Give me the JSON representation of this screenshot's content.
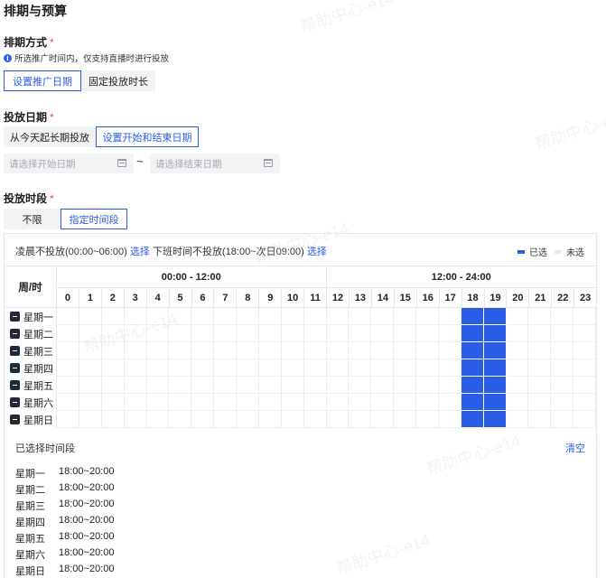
{
  "section_title": "排期与预算",
  "schedule_mode": {
    "label": "排期方式",
    "required_mark": "*",
    "info_text": "所选推广时间内，仅支持直播时进行投放",
    "options": [
      {
        "label": "设置推广日期",
        "active": true
      },
      {
        "label": "固定投放时长",
        "active": false
      }
    ]
  },
  "delivery_date": {
    "label": "投放日期",
    "required_mark": "*",
    "options": [
      {
        "label": "从今天起长期投放",
        "active": false
      },
      {
        "label": "设置开始和结束日期",
        "active": true
      }
    ],
    "start_placeholder": "请选择开始日期",
    "end_placeholder": "请选择结束日期",
    "separator": "~"
  },
  "time_slot": {
    "label": "投放时段",
    "required_mark": "*",
    "options": [
      {
        "label": "不限",
        "active": false
      },
      {
        "label": "指定时间段",
        "active": true
      }
    ]
  },
  "panel": {
    "quick1_text": "凌晨不投放(00:00~06:00)",
    "quick1_link": "选择",
    "quick2_text": "下班时间不投放(18:00~次日09:00)",
    "quick2_link": "选择",
    "legend_selected": "已选",
    "legend_unselected": "未选",
    "colors": {
      "selected": "#2b5ce6",
      "unselected": "#f0f1f3"
    },
    "corner_label": "周/时",
    "half_labels": [
      "00:00 - 12:00",
      "12:00 - 24:00"
    ],
    "hours": [
      "0",
      "1",
      "2",
      "3",
      "4",
      "5",
      "6",
      "7",
      "8",
      "9",
      "10",
      "11",
      "12",
      "13",
      "14",
      "15",
      "16",
      "17",
      "18",
      "19",
      "20",
      "21",
      "22",
      "23"
    ],
    "days": [
      "星期一",
      "星期二",
      "星期三",
      "星期四",
      "星期五",
      "星期六",
      "星期日"
    ],
    "selected_hours": [
      18,
      19
    ]
  },
  "summary": {
    "title": "已选择时间段",
    "clear_label": "清空",
    "rows": [
      {
        "day": "星期一",
        "range": "18:00~20:00"
      },
      {
        "day": "星期二",
        "range": "18:00~20:00"
      },
      {
        "day": "星期三",
        "range": "18:00~20:00"
      },
      {
        "day": "星期四",
        "range": "18:00~20:00"
      },
      {
        "day": "星期五",
        "range": "18:00~20:00"
      },
      {
        "day": "星期六",
        "range": "18:00~20:00"
      },
      {
        "day": "星期日",
        "range": "18:00~20:00"
      }
    ]
  }
}
